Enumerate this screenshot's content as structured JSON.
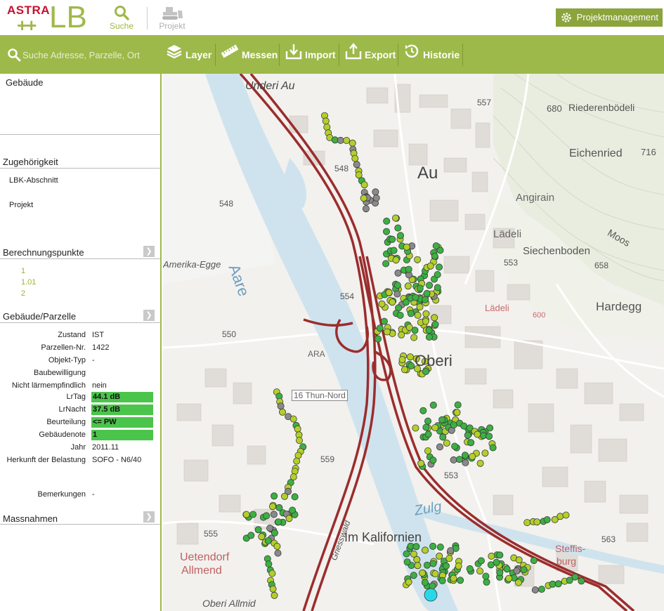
{
  "header": {
    "logo_top": "ASTRA",
    "logo_plus": "++",
    "logo_main": "LB",
    "suche_label": "Suche",
    "projekt_label": "Projekt",
    "pm_label": "Projektmanagement"
  },
  "toolbar": {
    "search_placeholder": "Suche Adresse, Parzelle, Ort",
    "layer_label": "Layer",
    "messen_label": "Messen",
    "import_label": "Import",
    "export_label": "Export",
    "historie_label": "Historie"
  },
  "sidebar": {
    "gebaeude_title": "Gebäude",
    "zugehoerigkeit_title": "Zugehörigkeit",
    "lbk_abschnitt": "LBK-Abschnitt",
    "projekt": "Projekt",
    "berechnungspunkte_title": "Berechnungspunkte",
    "berechnungspunkte": [
      "1",
      "1.01",
      "2"
    ],
    "gebaeude_parzelle_title": "Gebäude/Parzelle",
    "rows": [
      {
        "label": "Zustand",
        "value": "IST"
      },
      {
        "label": "Parzellen-Nr.",
        "value": "1422"
      },
      {
        "label": "Objekt-Typ",
        "value": "-"
      },
      {
        "label": "Baubewilligung",
        "value": ""
      },
      {
        "label": "Nicht lärmempfindlich",
        "value": "nein"
      }
    ],
    "badges": [
      {
        "label": "LrTag",
        "value": "44.1 dB"
      },
      {
        "label": "LrNacht",
        "value": "37.5 dB"
      },
      {
        "label": "Beurteilung",
        "value": "<= PW"
      },
      {
        "label": "Gebäudenote",
        "value": "1"
      }
    ],
    "jahr_label": "Jahr",
    "jahr_value": "2011.11",
    "herkunft_label": "Herkunft der Belastung",
    "herkunft_value": "SOFO - N6/40",
    "bemerkungen_label": "Bemerkungen",
    "bemerkungen_value": "-",
    "massnahmen_title": "Massnahmen"
  },
  "map": {
    "labels": {
      "underi_au": "Underi Au",
      "au": "Au",
      "amerika": "Amerika-Egge",
      "aare": "Aare",
      "angirain": "Angirain",
      "ladeli": "Lädeli",
      "ladeli_red": "Lädeli",
      "siechenboden": "Siechenboden",
      "riederenbodeli": "Riederenbödeli",
      "eichenried": "Eichenried",
      "moos": "Moos",
      "hardegg": "Hardegg",
      "oberi": "Oberi",
      "ara": "ARA",
      "thun": "16 Thun-Nord",
      "zulg": "Zulg",
      "im_kalifornien": "Im Kalifornien",
      "uetendorf": "Uetendorf",
      "allmend": "Allmend",
      "steffisburg1": "Steffis-",
      "steffisburg2": "burg",
      "oberi_allmid": "Oberi Allmid",
      "griesswald": "Griesswald",
      "e548a": "548",
      "e548b": "548",
      "e554": "554",
      "e550": "550",
      "e559": "559",
      "e553a": "553",
      "e553b": "553",
      "e557": "557",
      "e680": "680",
      "e716": "716",
      "e658": "658",
      "e555": "555",
      "e563": "563",
      "e600": "600"
    },
    "colors": {
      "green": "#3cb043",
      "yellowgreen": "#b3cf2a",
      "gray": "#8a8a8a",
      "cyan": "#28d8e8",
      "highway": "#9b2d2d",
      "river": "#cfe3ee"
    }
  }
}
